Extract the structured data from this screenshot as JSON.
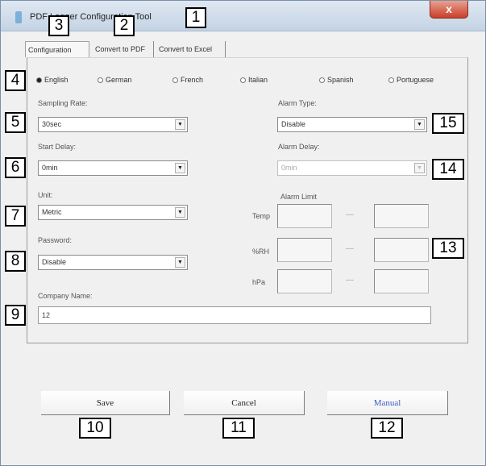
{
  "window": {
    "title": "PDF Logger Configuration Tool",
    "close_label": "x"
  },
  "tabs": [
    "Configuration",
    "Convert to PDF",
    "Convert to Excel"
  ],
  "languages": {
    "options": [
      "English",
      "German",
      "French",
      "Italian",
      "Spanish",
      "Portuguese"
    ],
    "selected": "English"
  },
  "fields": {
    "sampling_rate": {
      "label": "Sampling Rate:",
      "value": "30sec"
    },
    "start_delay": {
      "label": "Start Delay:",
      "value": "0min"
    },
    "unit": {
      "label": "Unit:",
      "value": "Metric"
    },
    "password": {
      "label": "Password:",
      "value": "Disable"
    },
    "alarm_type": {
      "label": "Alarm Type:",
      "value": "Disable"
    },
    "alarm_delay": {
      "label": "Alarm Delay:",
      "value": "0min"
    },
    "company_name": {
      "label": "Company Name:",
      "value": "12"
    }
  },
  "alarm_limit": {
    "label": "Alarm Limit",
    "rows": [
      {
        "label": "Temp",
        "separator": "—"
      },
      {
        "label": "%RH",
        "separator": "—"
      },
      {
        "label": "hPa",
        "separator": "—"
      }
    ]
  },
  "buttons": {
    "save": "Save",
    "cancel": "Cancel",
    "manual": "Manual"
  },
  "callouts": [
    "1",
    "2",
    "3",
    "4",
    "5",
    "6",
    "7",
    "8",
    "9",
    "10",
    "11",
    "12",
    "13",
    "14",
    "15"
  ]
}
